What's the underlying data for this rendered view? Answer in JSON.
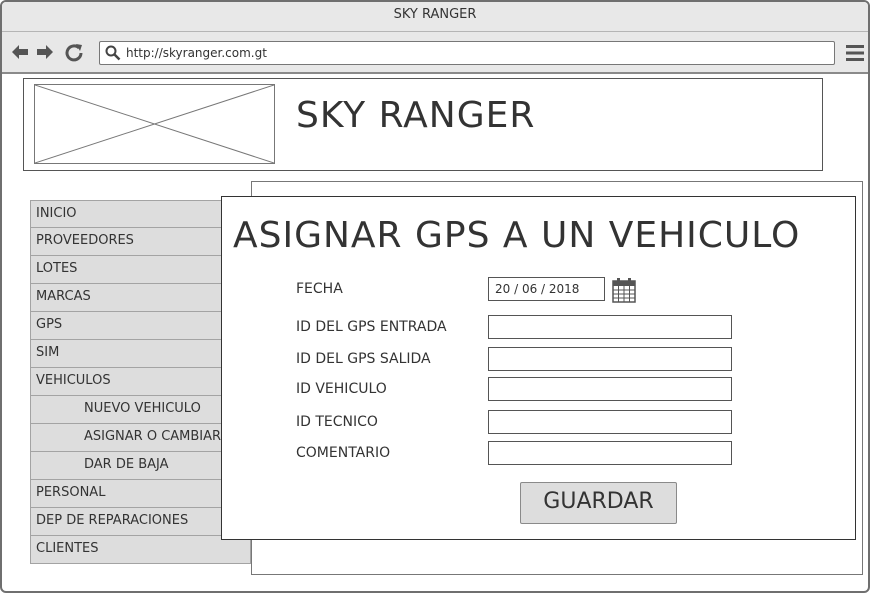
{
  "window": {
    "title": "SKY RANGER"
  },
  "browser": {
    "url": "http://skyranger.com.gt",
    "icons": [
      "back-arrow-icon",
      "forward-arrow-icon",
      "reload-icon",
      "search-icon",
      "hamburger-menu-icon"
    ]
  },
  "header": {
    "logo": "image-placeholder",
    "site_title": "SKY RANGER"
  },
  "sidebar": {
    "items": [
      {
        "label": "INICIO"
      },
      {
        "label": "PROVEEDORES"
      },
      {
        "label": "LOTES"
      },
      {
        "label": "MARCAS"
      },
      {
        "label": "GPS"
      },
      {
        "label": "SIM"
      },
      {
        "label": "VEHICULOS"
      },
      {
        "label": "NUEVO VEHICULO"
      },
      {
        "label": "ASIGNAR O CAMBIAR"
      },
      {
        "label": "DAR DE BAJA"
      },
      {
        "label": "PERSONAL"
      },
      {
        "label": "DEP DE REPARACIONES"
      },
      {
        "label": "CLIENTES"
      }
    ]
  },
  "form": {
    "title": "ASIGNAR GPS A UN VEHICULO",
    "fields": [
      {
        "label": "FECHA",
        "value": "20 / 06 / 2018"
      },
      {
        "label": "ID DEL GPS ENTRADA",
        "value": ""
      },
      {
        "label": "ID DEL GPS SALIDA",
        "value": ""
      },
      {
        "label": "ID VEHICULO",
        "value": ""
      },
      {
        "label": "ID TECNICO",
        "value": ""
      },
      {
        "label": "COMENTARIO",
        "value": ""
      }
    ],
    "calendar_icon": "calendar-icon",
    "save_label": "GUARDAR"
  }
}
